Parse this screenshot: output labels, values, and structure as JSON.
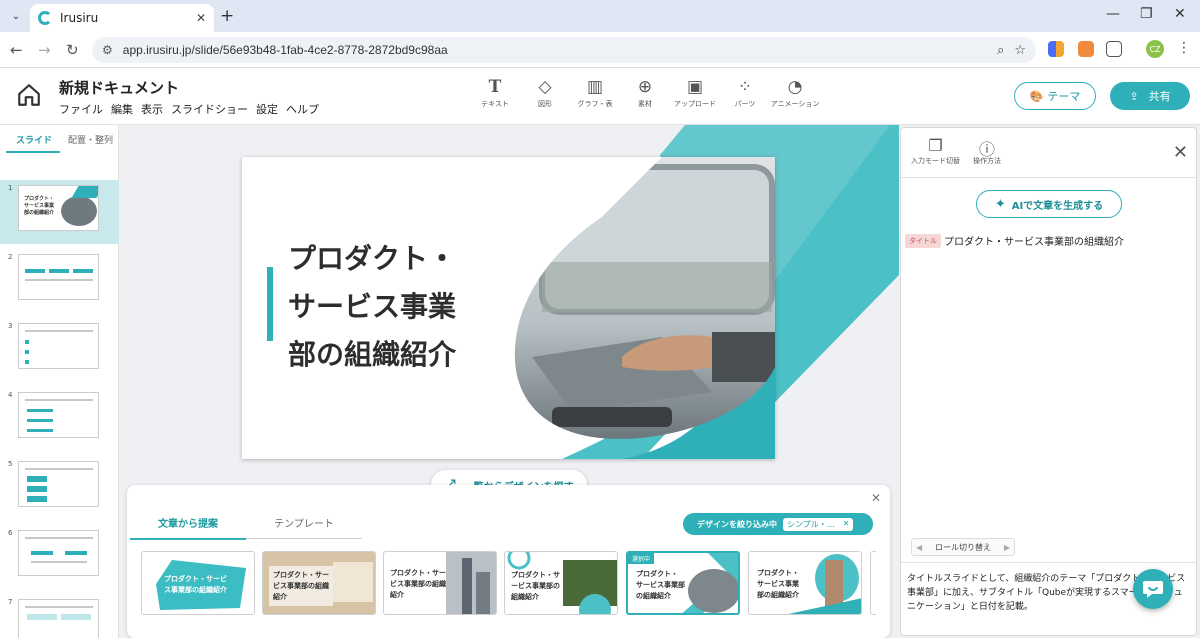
{
  "browser": {
    "tab_title": "Irusiru",
    "url": "app.irusiru.jp/slide/56e93b48-1fab-4ce2-8778-2872bd9c98aa",
    "profile_initials": "CZ"
  },
  "app": {
    "doc_title": "新規ドキュメント",
    "menus": [
      "ファイル",
      "編集",
      "表示",
      "スライドショー",
      "設定",
      "ヘルプ"
    ],
    "tools": [
      {
        "label": "テキスト",
        "icon": "T"
      },
      {
        "label": "図形",
        "icon": "◇"
      },
      {
        "label": "グラフ・表",
        "icon": "▥"
      },
      {
        "label": "素材",
        "icon": "⊕"
      },
      {
        "label": "アップロード",
        "icon": "▣"
      },
      {
        "label": "パーツ",
        "icon": "⁘"
      },
      {
        "label": "アニメーション",
        "icon": "◔"
      }
    ],
    "theme_label": "テーマ",
    "share_label": "共有"
  },
  "left_panel": {
    "tabs": [
      "スライド",
      "配置・整列"
    ],
    "slides": [
      "1",
      "2",
      "3",
      "4",
      "5",
      "6",
      "7"
    ],
    "thumb1_text": "プロダクト・\nサービス事業\n部の組織紹介"
  },
  "slide": {
    "title": "プロダクト・\nサービス事業\n部の組織紹介"
  },
  "design_panel": {
    "find_label": "一覧からデザインを探す",
    "tab_suggest": "文章から提案",
    "tab_template": "テンプレート",
    "filter_label": "デザインを絞り込み中",
    "filter_tag": "シンプル・…",
    "cards": [
      {
        "text": "プロダクト・サービ\nス事業部の組織紹介"
      },
      {
        "text": "プロダクト・サー\nビス事業部の組織\n紹介"
      },
      {
        "text": "プロダクト・サー\nビス事業部の組織\n紹介"
      },
      {
        "text": "プロダクト・サ\nービス事業部の\n組織紹介"
      },
      {
        "text": "プロダクト・\nサービス事業部\nの組織紹介",
        "badge": "選択中"
      },
      {
        "text": "プロダクト・\nサービス事業\n部の組織紹介"
      }
    ]
  },
  "right_panel": {
    "tool1": "入力モード切替",
    "tool2": "操作方法",
    "ai_label": "AIで文章を生成する",
    "role_tag": "タイトル",
    "role_text": "プロダクト・サービス事業部の組織紹介",
    "role_switch": "ロール切り替え",
    "description": "タイトルスライドとして、組織紹介のテーマ「プロダクト・サービス事業部」に加え、サブタイトル「Qubeが実現するスマートなコミュニケーション」と日付を記載。"
  }
}
